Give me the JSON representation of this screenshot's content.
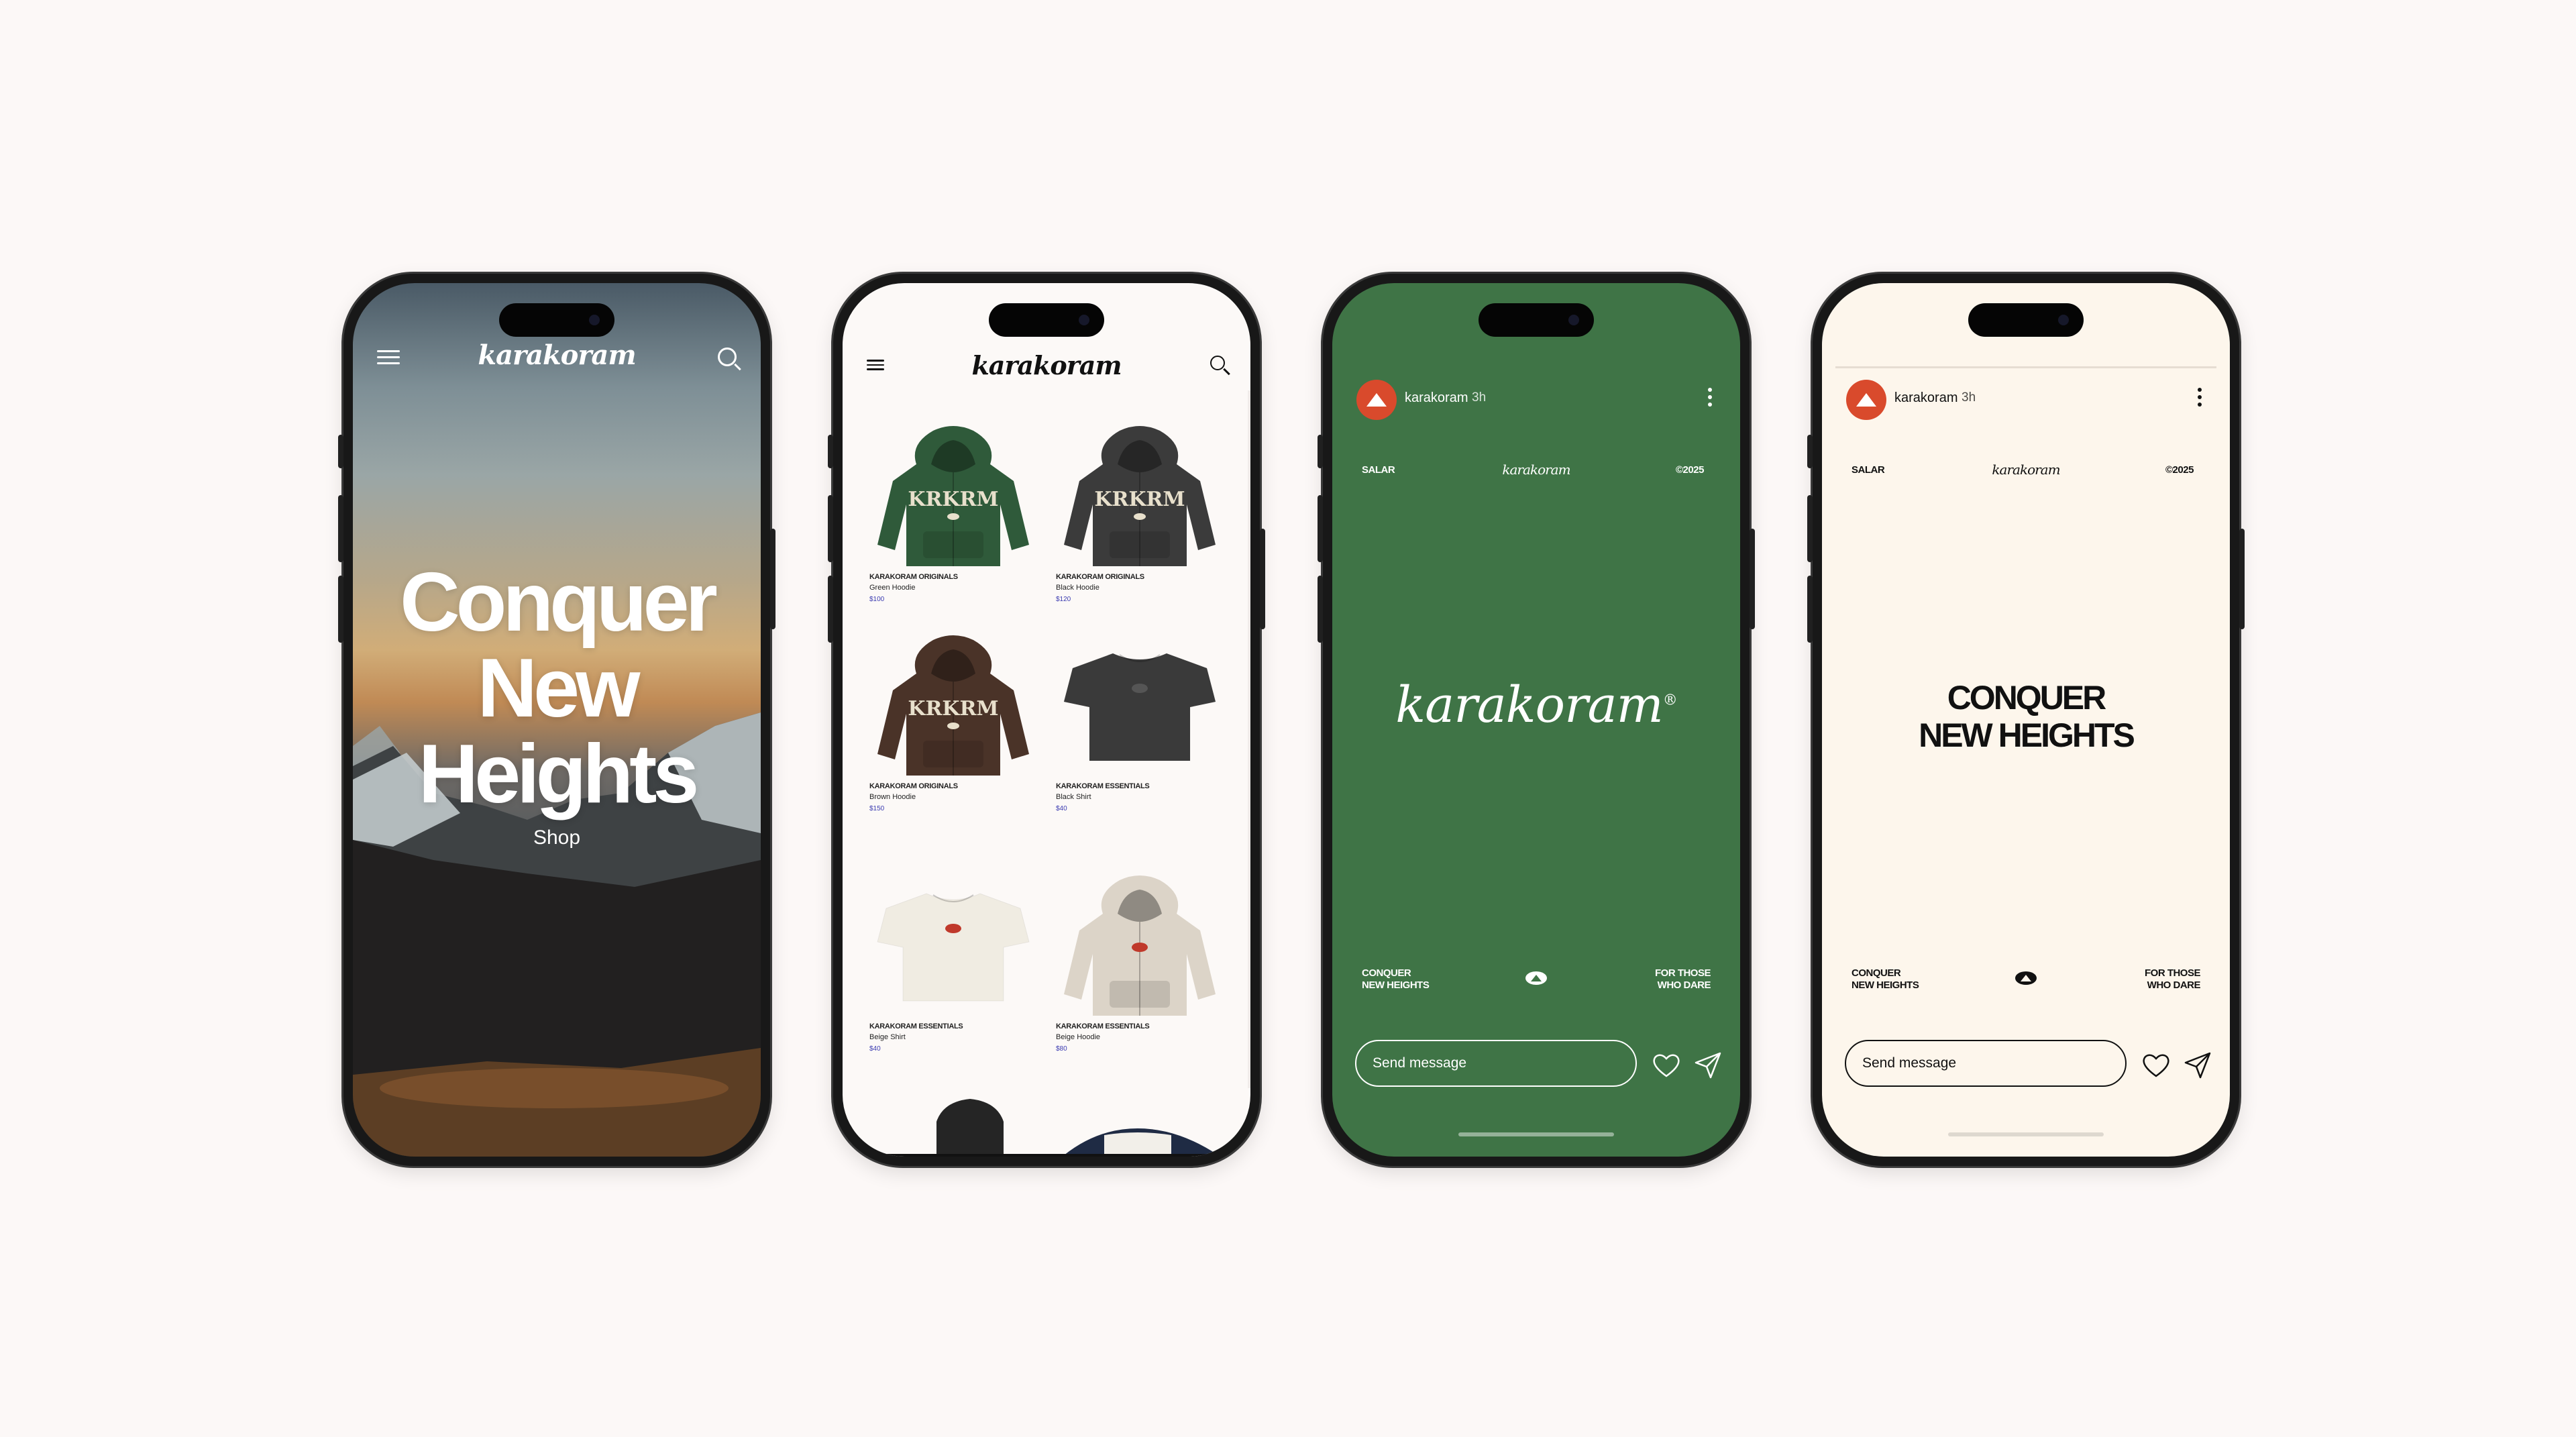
{
  "brand": "karakoram",
  "phone1": {
    "hero_line1": "Conquer",
    "hero_line2": "New",
    "hero_line3": "Heights",
    "cta": "Shop"
  },
  "phone2": {
    "products": [
      {
        "brand": "KARAKORAM ORIGINALS",
        "name": "Green Hoodie",
        "price": "$100",
        "color": "#2f5a3a",
        "print": "KRKRM"
      },
      {
        "brand": "KARAKORAM ORIGINALS",
        "name": "Black Hoodie",
        "price": "$120",
        "color": "#3b3b3b",
        "print": "KRKRM"
      },
      {
        "brand": "KARAKORAM ORIGINALS",
        "name": "Brown Hoodie",
        "price": "$150",
        "color": "#4a3328",
        "print": "KRKRM"
      },
      {
        "brand": "KARAKORAM ESSENTIALS",
        "name": "Black Shirt",
        "price": "$40",
        "color": "#3a3a3a"
      },
      {
        "brand": "KARAKORAM ESSENTIALS",
        "name": "Beige Shirt",
        "price": "$40",
        "color": "#f0ece2"
      },
      {
        "brand": "KARAKORAM ESSENTIALS",
        "name": "Beige Hoodie",
        "price": "$80",
        "color": "#dcd4c8"
      }
    ]
  },
  "story": {
    "username": "karakoram",
    "time": "3h",
    "top_left": "SALAR",
    "top_center": "karakoram",
    "top_right": "©2025",
    "center_logo": "karakoram",
    "registered": "®",
    "headline_line1": "CONQUER",
    "headline_line2": "NEW HEIGHTS",
    "bottom_left_line1": "CONQUER",
    "bottom_left_line2": "NEW HEIGHTS",
    "bottom_right_line1": "FOR THOSE",
    "bottom_right_line2": "WHO DARE",
    "send_placeholder": "Send message"
  },
  "colors": {
    "page_bg": "#fcf8f7",
    "story_green": "#3f7446",
    "story_cream": "#fdf6ec",
    "accent_red": "#d94a2c",
    "price_blue": "#3a3ab0"
  }
}
